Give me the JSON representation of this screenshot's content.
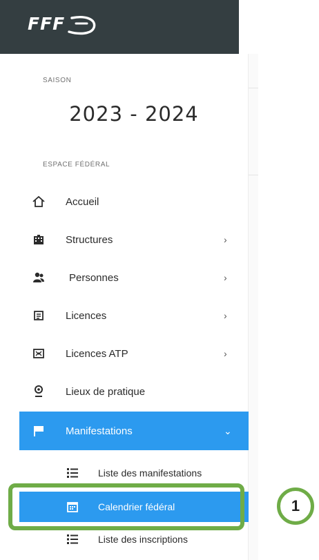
{
  "logo": {
    "text": "FFF"
  },
  "season": {
    "label": "SAISON",
    "value": "2023 - 2024"
  },
  "section": {
    "label": "ESPACE FÉDÉRAL"
  },
  "menu": [
    {
      "label": "Accueil",
      "icon": "home-icon",
      "chevron": ""
    },
    {
      "label": "Structures",
      "icon": "building-icon",
      "chevron": "›"
    },
    {
      "label": "Personnes",
      "icon": "people-icon",
      "chevron": "›"
    },
    {
      "label": "Licences",
      "icon": "card-icon",
      "chevron": "›"
    },
    {
      "label": "Licences ATP",
      "icon": "flag-checkered-icon",
      "chevron": "›"
    },
    {
      "label": "Lieux de pratique",
      "icon": "location-pin-icon",
      "chevron": ""
    },
    {
      "label": "Manifestations",
      "icon": "flag-icon",
      "chevron": "⌄"
    }
  ],
  "submenu": [
    {
      "label": "Liste des manifestations",
      "icon": "list-icon"
    },
    {
      "label": "Calendrier fédéral",
      "icon": "calendar-icon"
    },
    {
      "label": "Liste des inscriptions",
      "icon": "list-icon"
    }
  ],
  "annotation": {
    "number": "1"
  },
  "colors": {
    "accent": "#2c9aef",
    "header": "#343e41",
    "highlight": "#6fac47"
  }
}
